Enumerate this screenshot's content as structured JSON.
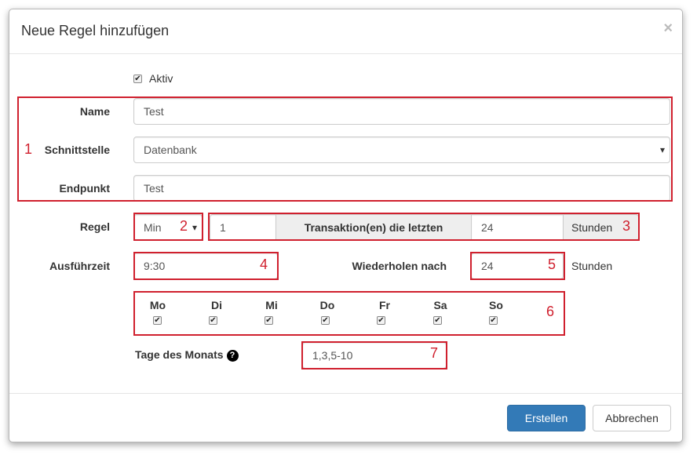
{
  "dialog": {
    "title": "Neue Regel hinzufügen",
    "close_icon": "×"
  },
  "aktiv": {
    "label": "Aktiv",
    "checked": true
  },
  "labels": {
    "name": "Name",
    "schnittstelle": "Schnittstelle",
    "endpunkt": "Endpunkt",
    "regel": "Regel",
    "ausfuehrzeit": "Ausführzeit",
    "wiederholen": "Wiederholen nach",
    "tage_des_monats": "Tage des Monats"
  },
  "fields": {
    "name": "Test",
    "schnittstelle": "Datenbank",
    "endpunkt": "Test",
    "regel_mode": "Min",
    "regel_count": "1",
    "regel_middle": "Transaktion(en) die letzten",
    "regel_hours": "24",
    "regel_unit": "Stunden",
    "ausfuehrzeit": "9:30",
    "wiederholen": "24",
    "wiederholen_unit": "Stunden",
    "tage_des_monats": "1,3,5-10"
  },
  "weekdays": [
    {
      "label": "Mo",
      "checked": true
    },
    {
      "label": "Di",
      "checked": true
    },
    {
      "label": "Mi",
      "checked": true
    },
    {
      "label": "Do",
      "checked": true
    },
    {
      "label": "Fr",
      "checked": true
    },
    {
      "label": "Sa",
      "checked": true
    },
    {
      "label": "So",
      "checked": true
    }
  ],
  "annotations": [
    "1",
    "2",
    "3",
    "4",
    "5",
    "6",
    "7"
  ],
  "help_icon": "?",
  "check_glyph": "✔",
  "caret_glyph": "▾",
  "buttons": {
    "create": "Erstellen",
    "cancel": "Abbrechen"
  },
  "colors": {
    "annotation": "#d0202e",
    "primary": "#337ab7"
  }
}
